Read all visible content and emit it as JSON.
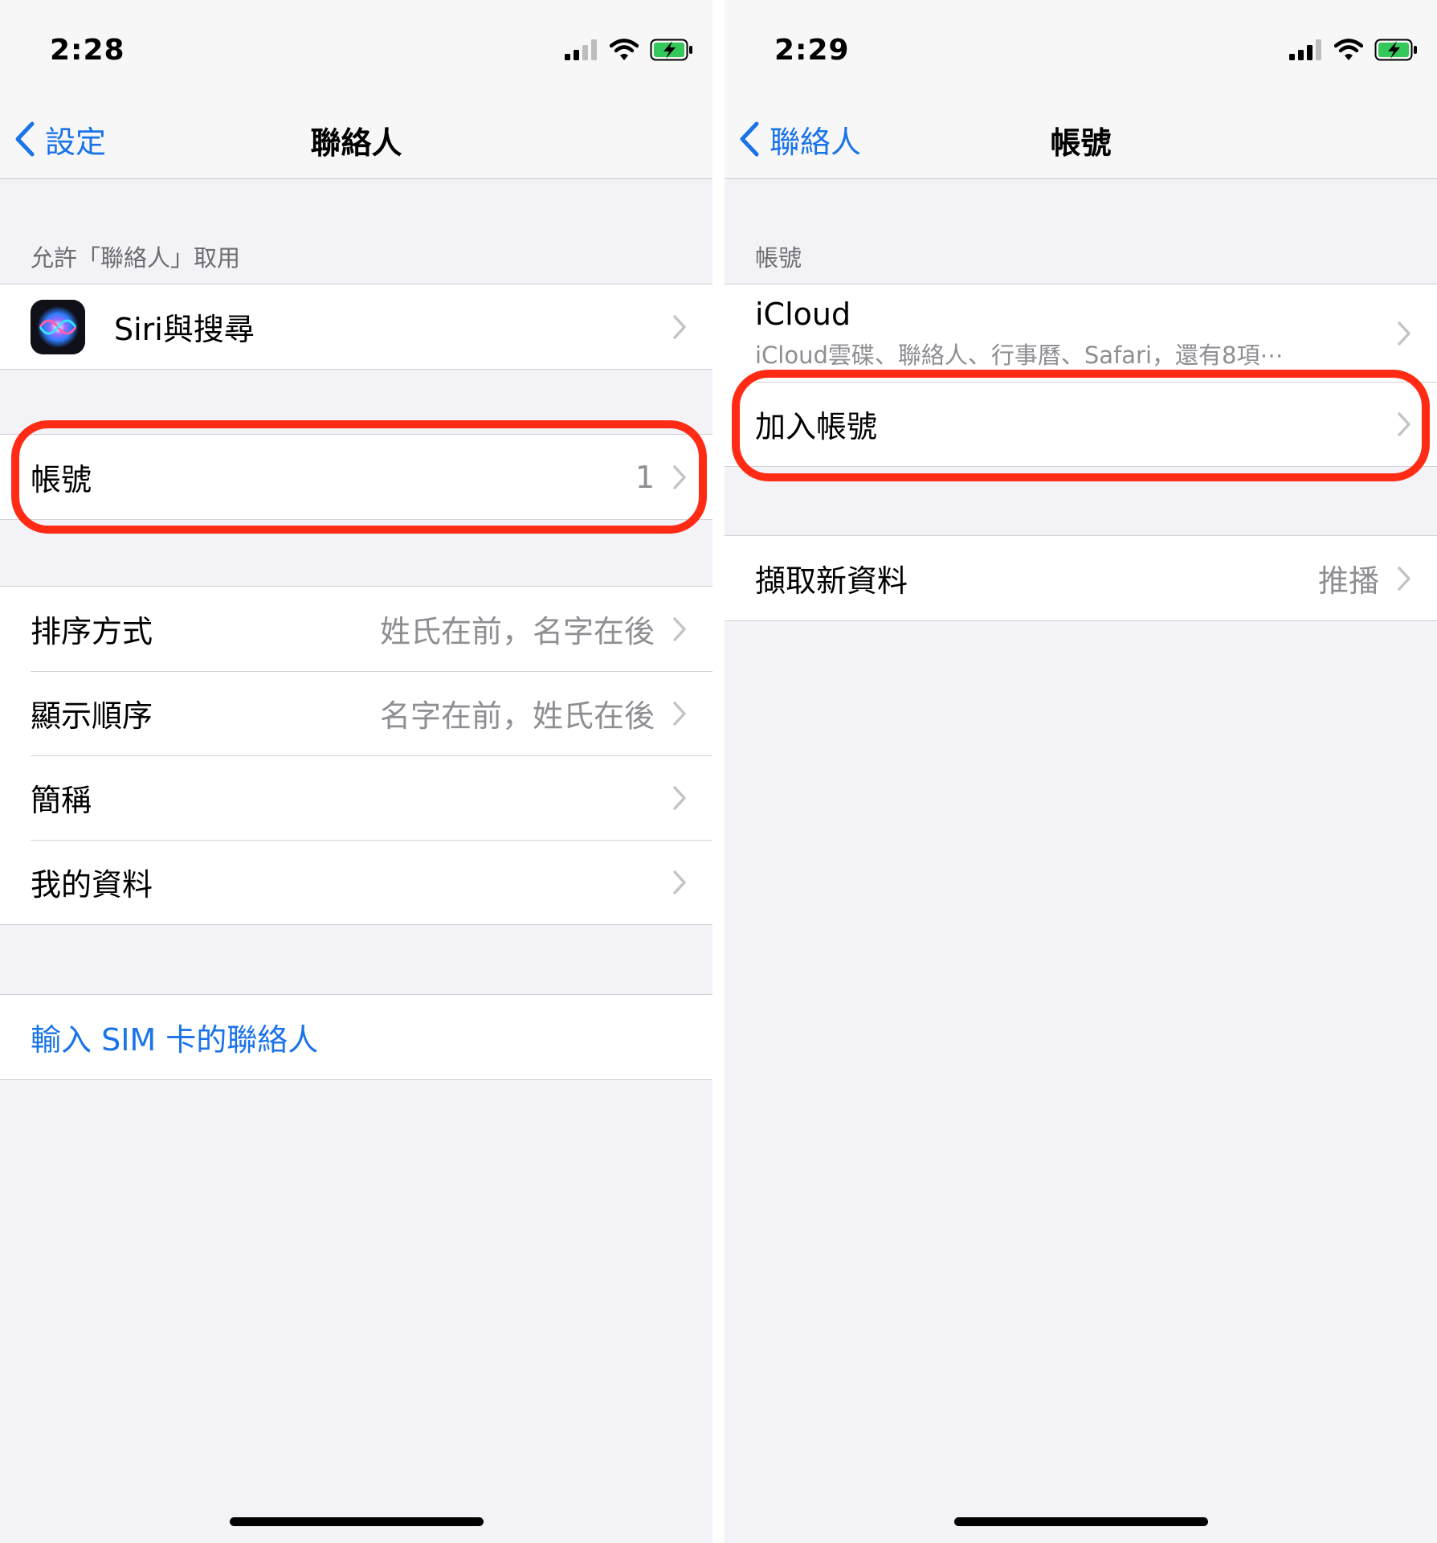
{
  "left": {
    "status": {
      "time": "2:28"
    },
    "nav": {
      "back_label": "設定",
      "title": "聯絡人"
    },
    "section_header": "允許「聯絡人」取用",
    "siri_row": {
      "label": "Siri與搜尋",
      "icon": "siri-icon"
    },
    "accounts_row": {
      "label": "帳號",
      "value": "1"
    },
    "settings_rows": [
      {
        "label": "排序方式",
        "value": "姓氏在前，名字在後"
      },
      {
        "label": "顯示順序",
        "value": "名字在前，姓氏在後"
      },
      {
        "label": "簡稱",
        "value": ""
      },
      {
        "label": "我的資料",
        "value": ""
      }
    ],
    "sim_import": {
      "label": "輸入 SIM 卡的聯絡人"
    }
  },
  "right": {
    "status": {
      "time": "2:29"
    },
    "nav": {
      "back_label": "聯絡人",
      "title": "帳號"
    },
    "section_header": "帳號",
    "icloud_row": {
      "title": "iCloud",
      "subtitle": "iCloud雲碟、聯絡人、行事曆、Safari，還有8項⋯"
    },
    "add_account_row": {
      "label": "加入帳號"
    },
    "fetch_row": {
      "label": "擷取新資料",
      "value": "推播"
    }
  },
  "colors": {
    "link_blue": "#1a73e8",
    "highlight_red": "#ff2b14",
    "battery_green": "#34c759",
    "background": "#f2f2f7"
  }
}
